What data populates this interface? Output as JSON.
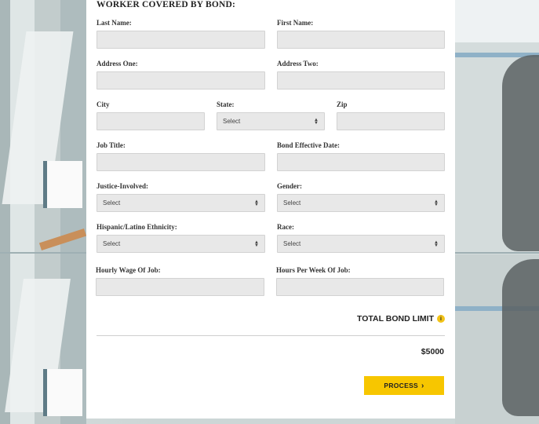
{
  "form": {
    "section_title": "WORKER COVERED BY BOND:",
    "fields": {
      "last_name": {
        "label": "Last Name:",
        "value": ""
      },
      "first_name": {
        "label": "First Name:",
        "value": ""
      },
      "address_one": {
        "label": "Address One:",
        "value": ""
      },
      "address_two": {
        "label": "Address Two:",
        "value": ""
      },
      "city": {
        "label": "City",
        "value": ""
      },
      "state": {
        "label": "State:",
        "selected": "Select"
      },
      "zip": {
        "label": "Zip",
        "value": ""
      },
      "job_title": {
        "label": "Job Title:",
        "value": ""
      },
      "bond_effective_date": {
        "label": "Bond Effective Date:",
        "value": ""
      },
      "justice_involved": {
        "label": "Justice-Involved:",
        "selected": "Select"
      },
      "gender": {
        "label": "Gender:",
        "selected": "Select"
      },
      "hispanic_latino": {
        "label": "Hispanic/Latino Ethnicity:",
        "selected": "Select"
      },
      "race": {
        "label": "Race:",
        "selected": "Select"
      },
      "hourly_wage": {
        "label": "Hourly Wage Of Job:",
        "value": ""
      },
      "hours_per_week": {
        "label": "Hours Per Week Of Job:",
        "value": ""
      }
    },
    "total": {
      "label": "TOTAL BOND LIMIT",
      "info_icon": "info-icon",
      "amount": "$5000"
    },
    "process_button": {
      "label": "PROCESS",
      "icon": "chevron-right-icon"
    }
  },
  "colors": {
    "accent": "#f7c600",
    "input_bg": "#e8e8e8",
    "panel_bg": "#ffffff"
  }
}
